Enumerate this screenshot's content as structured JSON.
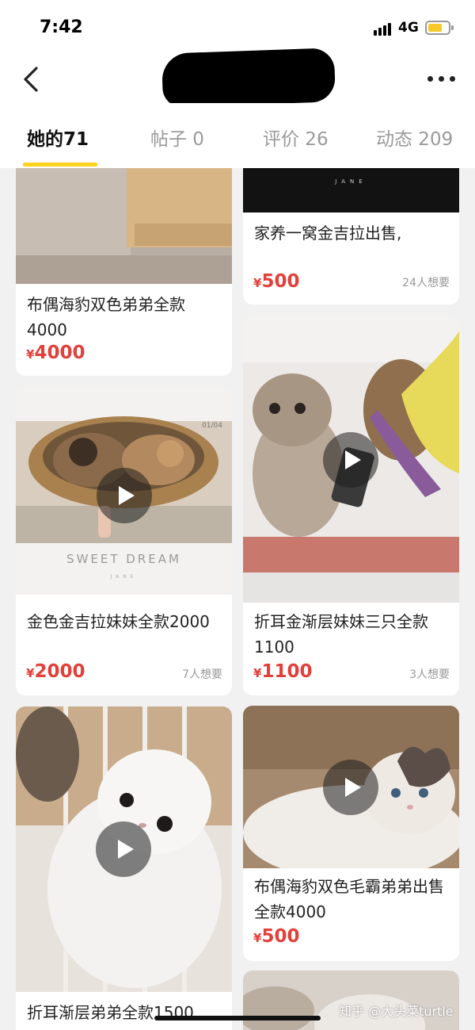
{
  "status_bar": {
    "time": "7:42",
    "network": "4G",
    "battery_level": 0.65,
    "battery_color": "#f6c928"
  },
  "header": {
    "back_icon": "chevron-left-icon",
    "more_icon": "more-horizontal-icon"
  },
  "tabs": [
    {
      "label": "她的71"
    },
    {
      "label": "帖子 0"
    },
    {
      "label": "评价 26"
    },
    {
      "label": "动态 209"
    }
  ],
  "colors": {
    "accent": "#ffd21e",
    "price": "#e2403b"
  },
  "listings": [
    {
      "title": "布偶海豹双色弟弟全款4000",
      "currency": "¥",
      "price": "4000",
      "wants": ""
    },
    {
      "title": "家养一窝金吉拉出售,",
      "currency": "¥",
      "price": "500",
      "wants": "24人想要"
    },
    {
      "title": "金色金吉拉妹妹全款2000",
      "currency": "¥",
      "price": "2000",
      "wants": "7人想要",
      "image_text": {
        "counter": "01/04",
        "caption": "SWEET DREAM",
        "brand": "JANE"
      }
    },
    {
      "title": "折耳金渐层妹妹三只全款1100",
      "currency": "¥",
      "price": "1100",
      "wants": "3人想要"
    },
    {
      "title": "折耳渐层弟弟全款1500",
      "currency": "¥",
      "price": "",
      "wants": ""
    },
    {
      "title": "布偶海豹双色毛霸弟弟出售全款4000",
      "currency": "¥",
      "price": "500",
      "wants": ""
    }
  ],
  "top_image_brand": "JANE",
  "watermark": "知乎 @大头菜turtle"
}
